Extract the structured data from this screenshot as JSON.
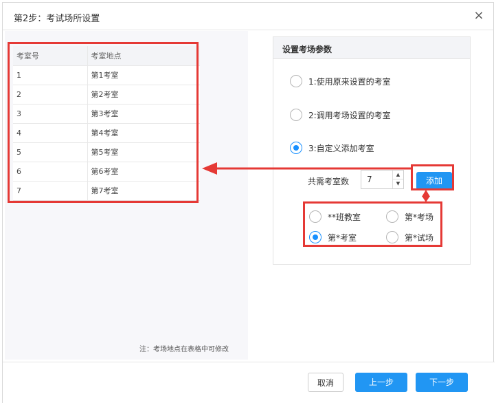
{
  "dialog": {
    "title": "第2步：考试场所设置",
    "close_label": "×"
  },
  "table": {
    "headers": [
      "考室号",
      "考室地点"
    ],
    "rows": [
      [
        "1",
        "第1考室"
      ],
      [
        "2",
        "第2考室"
      ],
      [
        "3",
        "第3考室"
      ],
      [
        "4",
        "第4考室"
      ],
      [
        "5",
        "第5考室"
      ],
      [
        "6",
        "第6考室"
      ],
      [
        "7",
        "第7考室"
      ]
    ],
    "note": "注：考场地点在表格中可修改"
  },
  "settings": {
    "header": "设置考场参数",
    "options": [
      {
        "label": "1:使用原来设置的考室",
        "checked": false
      },
      {
        "label": "2:调用考场设置的考室",
        "checked": false
      },
      {
        "label": "3:自定义添加考室",
        "checked": true
      }
    ],
    "count_label": "共需考室数",
    "count_value": "7",
    "spin_up": "▲",
    "spin_down": "▼",
    "add_label": "添加",
    "name_formats": [
      {
        "label": "**班教室",
        "checked": false
      },
      {
        "label": "第*考场",
        "checked": false
      },
      {
        "label": "第*考室",
        "checked": true
      },
      {
        "label": "第*试场",
        "checked": false
      }
    ]
  },
  "footer": {
    "cancel": "取消",
    "prev": "上一步",
    "next": "下一步"
  },
  "colors": {
    "primary": "#2196f3",
    "annotation": "#e53935"
  }
}
